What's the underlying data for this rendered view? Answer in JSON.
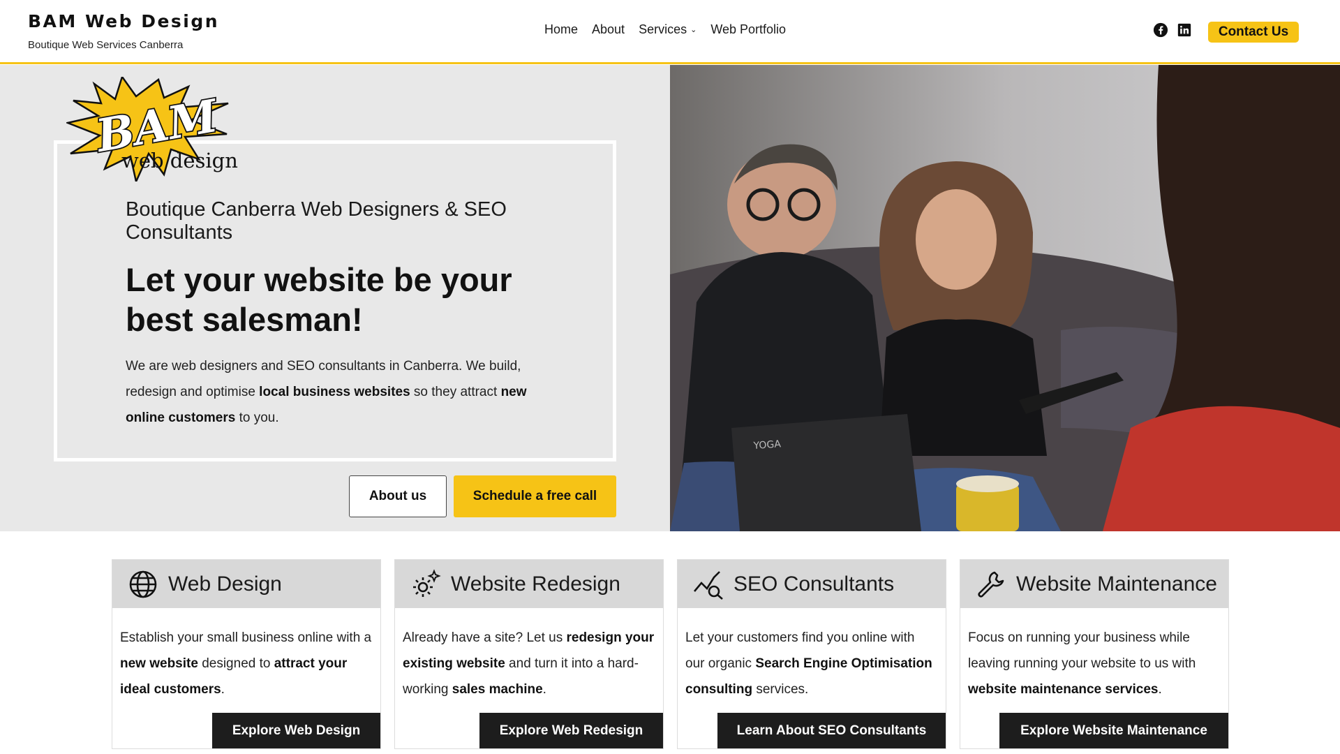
{
  "header": {
    "brand_title": "BAM Web Design",
    "brand_subtitle": "Boutique Web Services Canberra",
    "nav": [
      "Home",
      "About",
      "Services",
      "Web Portfolio"
    ],
    "social_icons": [
      "facebook-icon",
      "linkedin-icon"
    ],
    "contact_label": "Contact Us"
  },
  "hero": {
    "logo_top": "BAM",
    "logo_bottom": "web design",
    "subtitle": "Boutique Canberra Web Designers & SEO Consultants",
    "title": "Let your website be your best salesman!",
    "text_1": "We are web designers and SEO consultants in Canberra. We build, redesign and optimise ",
    "text_bold_1": "local business websites",
    "text_2": " so they attract ",
    "text_bold_2": "new online customers",
    "text_3": " to you.",
    "btn_about": "About us",
    "btn_call": "Schedule a free call",
    "photo_laptop_text": "YOGA"
  },
  "cards": [
    {
      "icon": "globe-icon",
      "title": "Web Design",
      "p1": "Establish your small business online with a ",
      "b1": "new website",
      "p2": " designed to ",
      "b2": "attract your ideal customers",
      "p3": ".",
      "button": "Explore Web Design"
    },
    {
      "icon": "gear-sparkle-icon",
      "title": "Website Redesign",
      "p1": "Already have a site? Let us ",
      "b1": "redesign your existing website",
      "p2": " and turn it into a hard-working ",
      "b2": "sales machine",
      "p3": ".",
      "button": "Explore Web Redesign"
    },
    {
      "icon": "chart-search-icon",
      "title": "SEO Consultants",
      "p1": "Let your customers find you online with our organic ",
      "b1": "Search Engine Optimisation consulting",
      "p2": " services.",
      "b2": "",
      "p3": "",
      "button": "Learn About SEO Consultants"
    },
    {
      "icon": "wrench-icon",
      "title": "Website Maintenance",
      "p1": "Focus on running your business while leaving running your website to us with ",
      "b1": "website maintenance services",
      "p2": ".",
      "b2": "",
      "p3": "",
      "button": "Explore Website Maintenance"
    }
  ],
  "colors": {
    "accent": "#f6c316",
    "hero_bg": "#e8e8e8",
    "card_head": "#d8d8d8",
    "dark_button": "#1d1d1d"
  }
}
